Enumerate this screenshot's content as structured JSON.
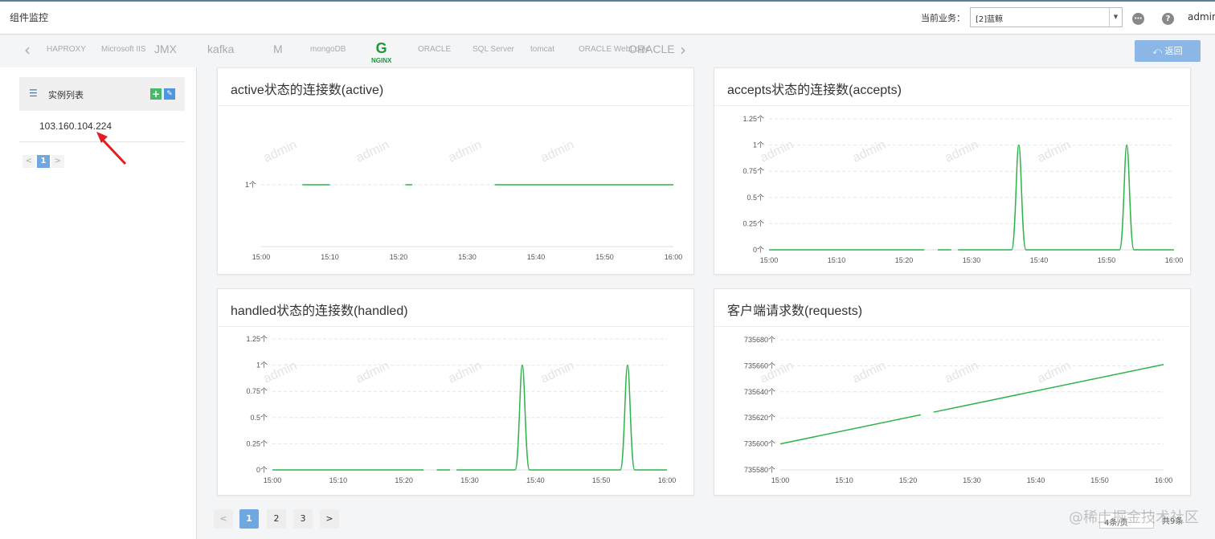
{
  "header": {
    "title": "组件监控",
    "biz_label": "当前业务：",
    "biz_value": "[2]蓝鲸",
    "user": "admin"
  },
  "logos": [
    "HAPROXY",
    "Microsoft IIS",
    "JMX",
    "kafka",
    "M",
    "mongoDB",
    "NGINX",
    "ORACLE",
    "SQL Server",
    "tomcat",
    "ORACLE WebLogic",
    "ORACLE"
  ],
  "back_label": "返回",
  "sidebar": {
    "title": "实例列表",
    "add_icon": "+",
    "instance": "103.160.104.224",
    "pager": {
      "prev": "<",
      "page": "1",
      "next": ">"
    }
  },
  "watermark": "admin",
  "charts": [
    {
      "title": "active状态的连接数(active)",
      "chart_data": {
        "type": "line",
        "x": [
          "15:00",
          "15:10",
          "15:20",
          "15:30",
          "15:40",
          "15:50",
          "16:00"
        ],
        "y_ticks": [
          "1个"
        ],
        "segments": [
          [
            "15:06",
            "15:10",
            1
          ],
          [
            "15:21",
            "15:22",
            1
          ],
          [
            "15:34",
            "16:00",
            1
          ]
        ]
      }
    },
    {
      "title": "accepts状态的连接数(accepts)",
      "chart_data": {
        "type": "line",
        "x": [
          "15:00",
          "15:10",
          "15:20",
          "15:30",
          "15:40",
          "15:50",
          "16:00"
        ],
        "y_ticks": [
          "0个",
          "0.25个",
          "0.5个",
          "0.75个",
          "1个",
          "1.25个"
        ],
        "ylim": [
          0,
          1.25
        ],
        "peaks": [
          {
            "x": "15:37",
            "y": 1
          },
          {
            "x": "15:53",
            "y": 1
          }
        ]
      }
    },
    {
      "title": "handled状态的连接数(handled)",
      "chart_data": {
        "type": "line",
        "x": [
          "15:00",
          "15:10",
          "15:20",
          "15:30",
          "15:40",
          "15:50",
          "16:00"
        ],
        "y_ticks": [
          "0个",
          "0.25个",
          "0.5个",
          "0.75个",
          "1个",
          "1.25个"
        ],
        "ylim": [
          0,
          1.25
        ],
        "peaks": [
          {
            "x": "15:38",
            "y": 1
          },
          {
            "x": "15:54",
            "y": 1
          }
        ]
      }
    },
    {
      "title": "客户端请求数(requests)",
      "chart_data": {
        "type": "line",
        "x": [
          "15:00",
          "15:10",
          "15:20",
          "15:30",
          "15:40",
          "15:50",
          "16:00"
        ],
        "y_ticks": [
          "735580个",
          "735600个",
          "735620个",
          "735640个",
          "735660个",
          "735680个"
        ],
        "ylim": [
          735580,
          735680
        ],
        "start": {
          "x": "15:00",
          "y": 735600
        },
        "end": {
          "x": "16:00",
          "y": 735661
        }
      }
    }
  ],
  "pagination": {
    "prev": "<",
    "pages": [
      "1",
      "2",
      "3"
    ],
    "next": ">"
  },
  "per_page": "4条/页",
  "total": "共9条",
  "site_watermark": "@稀土掘金技术社区",
  "colors": {
    "line": "#2db34a",
    "accent": "#6fa7e0"
  }
}
